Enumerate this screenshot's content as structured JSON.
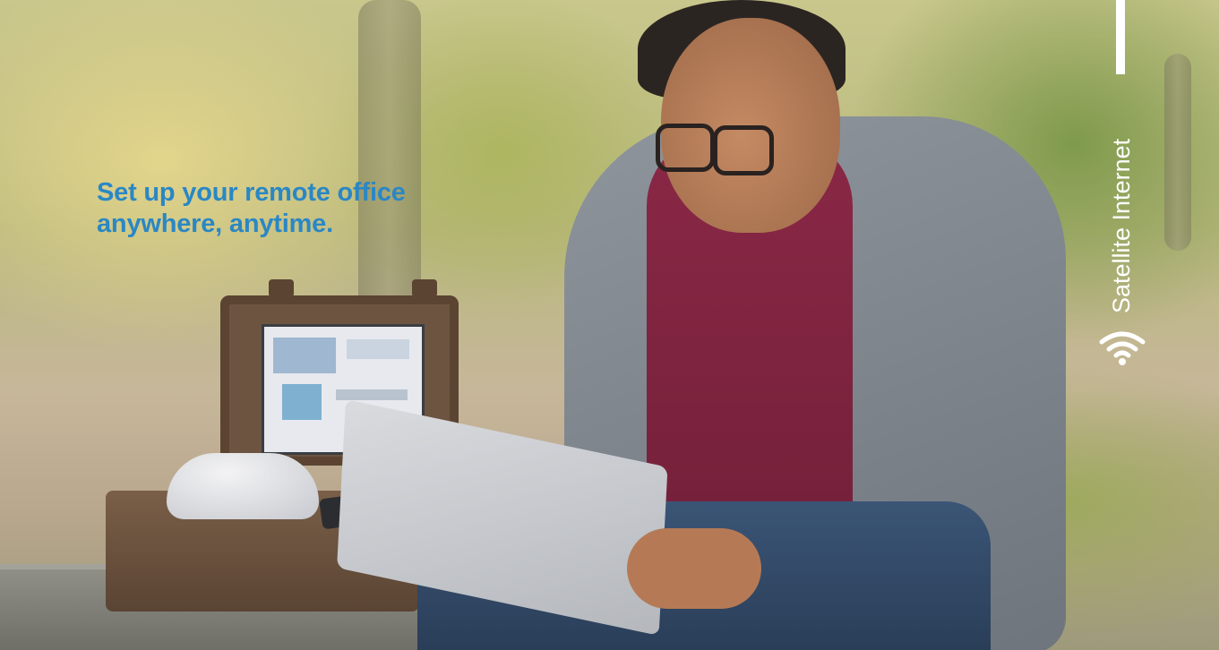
{
  "hero": {
    "headline_line1": "Set up your remote office",
    "headline_line2": "anywhere, anytime.",
    "side_label": "Satellite Internet",
    "accent_color": "#2a87c5",
    "side_icon": "wifi-signal-icon"
  }
}
